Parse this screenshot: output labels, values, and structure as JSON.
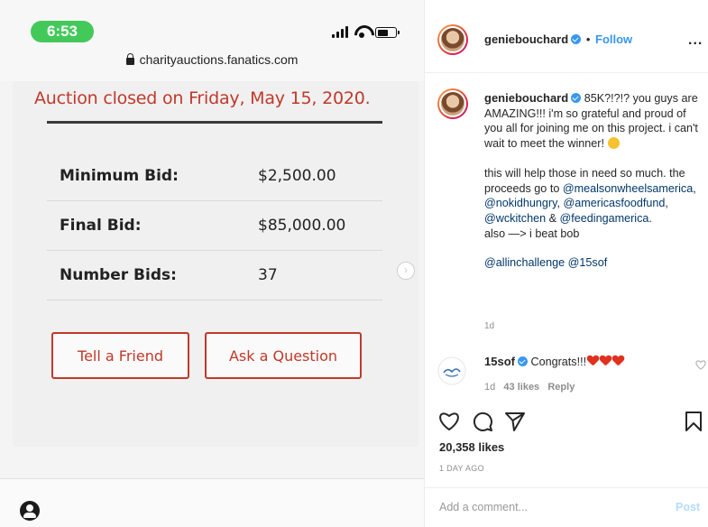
{
  "phone": {
    "time": "6:53",
    "url": "charityauctions.fanatics.com",
    "auction": {
      "closed_text": "Auction closed on Friday, May 15, 2020.",
      "rows": [
        {
          "label": "Minimum Bid:",
          "value": "$2,500.00"
        },
        {
          "label": "Final Bid:",
          "value": "$85,000.00"
        },
        {
          "label": "Number Bids:",
          "value": "37"
        }
      ],
      "tell_friend_label": "Tell a Friend",
      "ask_question_label": "Ask a Question"
    },
    "icons": {
      "signal": "signal-icon",
      "wifi": "wifi-icon",
      "battery": "battery-icon",
      "lock": "lock-icon",
      "next": "chevron-right-icon",
      "account": "account-icon"
    }
  },
  "instagram": {
    "header": {
      "username": "geniebouchard",
      "separator": "•",
      "follow_label": "Follow",
      "more_label": "..."
    },
    "caption": {
      "username": "geniebouchard",
      "text_1": "85K?!?!? you guys are AMAZING!!! i'm so grateful and proud of you all for joining me on this project. i can't wait to meet the winner!",
      "text_2_pre": "this will help those in need so much. the proceeds go to",
      "mention_mealsonwheels": "@mealsonwheelsamerica",
      "mention_nokidhungry": "@nokidhungry",
      "mention_americasfoodfund": "@americasfoodfund",
      "mention_wckitchen": "@wckitchen",
      "amp": "&",
      "mention_feedingamerica": "@feedingamerica",
      "text_2_post": "also —> i beat bob",
      "mention_allinchallenge": "@allinchallenge",
      "mention_15sof": "@15sof",
      "time": "1d"
    },
    "comment": {
      "username": "15sof",
      "text": "Congrats!!!",
      "time": "1d",
      "likes": "43 likes",
      "reply_label": "Reply"
    },
    "likes": "20,358 likes",
    "post_time": "1 DAY AGO",
    "comment_placeholder": "Add a comment...",
    "post_label": "Post",
    "colors": {
      "link": "#3897f0",
      "mention": "#00376b",
      "auction_red": "#c0392b"
    }
  }
}
